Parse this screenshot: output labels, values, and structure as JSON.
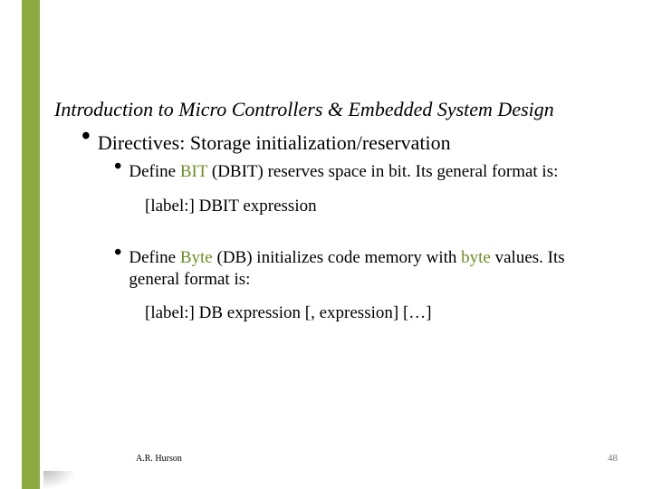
{
  "title": "Introduction to Micro Controllers & Embedded System Design",
  "level1": {
    "label": "Directives:",
    "rest": " Storage initialization/reservation"
  },
  "bit": {
    "pre": "Define ",
    "kw": "BIT",
    "post1": " (DBIT) reserves space in bit.  Its general format is:",
    "syntax_label": "[label:]",
    "syntax_kw": "DBIT",
    "syntax_rest": "   expression"
  },
  "byte": {
    "pre": "Define ",
    "kw": "Byte",
    "mid1": " (DB) initializes code memory with ",
    "kw2": "byte",
    "post": " values.  Its general format is:",
    "syntax_label": "[label:]",
    "syntax_kw": "DB",
    "syntax_rest": "   expression [, expression] […]"
  },
  "footer": {
    "author": "A.R. Hurson",
    "page": "48"
  }
}
